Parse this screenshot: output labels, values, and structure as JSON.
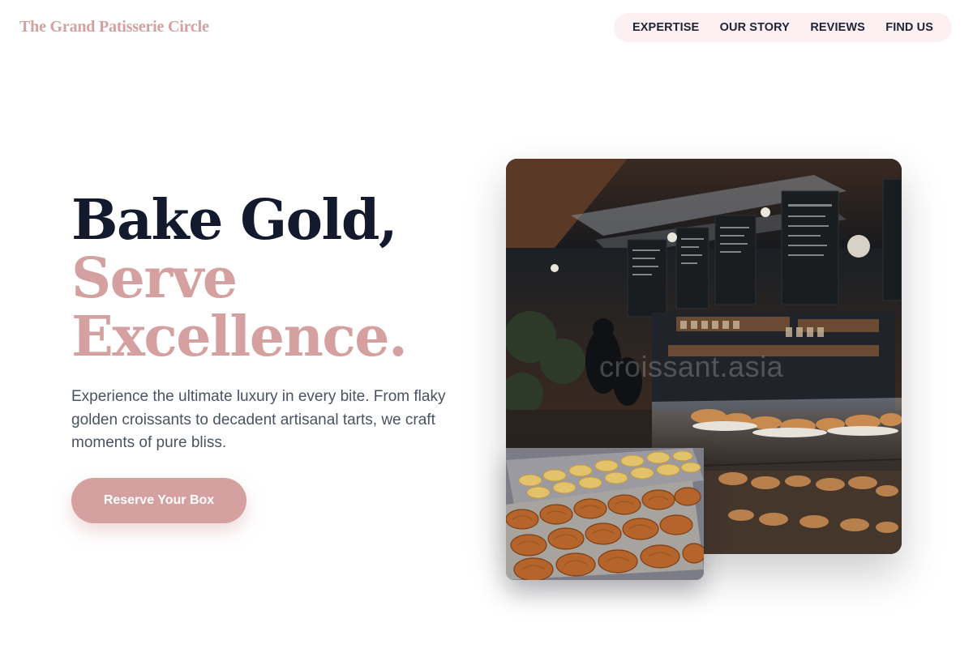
{
  "header": {
    "brand": "The Grand Patisserie Circle",
    "nav": [
      {
        "label": "EXPERTISE"
      },
      {
        "label": "OUR STORY"
      },
      {
        "label": "REVIEWS"
      },
      {
        "label": "FIND US"
      }
    ]
  },
  "hero": {
    "headline_line1": "Bake Gold,",
    "headline_line2": "Serve",
    "headline_line3": "Excellence.",
    "subtext": "Experience the ultimate luxury in every bite. From flaky golden croissants to decadent artisanal tarts, we craft moments of pure bliss.",
    "cta_label": "Reserve Your Box"
  },
  "images": {
    "main_photo_watermark": "croissant.asia",
    "main_photo_alt": "bakery-interior-photo",
    "inset_photo_alt": "pastry-tray-photo"
  },
  "colors": {
    "accent": "#d4a0a0",
    "nav_pill_bg": "#fdf0f2",
    "headline_dark": "#141a2e",
    "body_text": "#4a5263"
  }
}
